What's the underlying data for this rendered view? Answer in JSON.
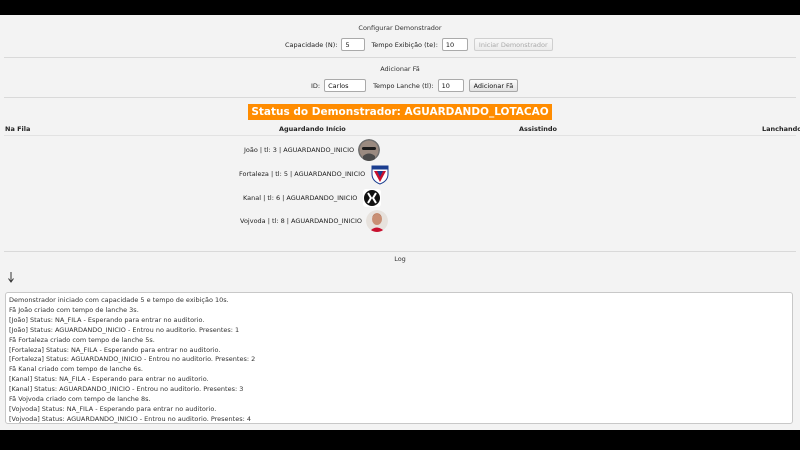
{
  "config": {
    "title": "Configurar Demonstrador",
    "capacity_label": "Capacidade (N):",
    "capacity_value": "5",
    "exhibit_label": "Tempo Exibição (te):",
    "exhibit_value": "10",
    "start_button": "Iniciar Demonstrador"
  },
  "add_fan": {
    "title": "Adicionar Fã",
    "id_label": "ID:",
    "id_value": "Carlos",
    "lunch_label": "Tempo Lanche (tl):",
    "lunch_value": "10",
    "add_button": "Adicionar Fã"
  },
  "status": {
    "text": "Status do Demonstrador: AGUARDANDO_LOTACAO",
    "color": "#ff8c00"
  },
  "columns": {
    "queue": "Na Fila",
    "waiting": "Aguardando Início",
    "watching": "Assistindo",
    "eating": "Lanchando"
  },
  "waiting_fans": [
    {
      "text": "João | tl: 3 | AGUARDANDO_INICIO",
      "avatar": "person-avatar-icon"
    },
    {
      "text": "Fortaleza | tl: 5 | AGUARDANDO_INICIO",
      "avatar": "fortaleza-crest-icon"
    },
    {
      "text": "Kanal | tl: 6 | AGUARDANDO_INICIO",
      "avatar": "kanal-logo-icon"
    },
    {
      "text": "Vojvoda | tl: 8 | AGUARDANDO_INICIO",
      "avatar": "person-avatar-icon"
    }
  ],
  "log": {
    "title": "Log",
    "lines": [
      "Demonstrador iniciado com capacidade 5 e tempo de exibição 10s.",
      "Fã João criado com tempo de lanche 3s.",
      "[João] Status: NA_FILA - Esperando para entrar no auditorio.",
      "[João] Status: AGUARDANDO_INICIO - Entrou no auditorio. Presentes: 1",
      "Fã Fortaleza criado com tempo de lanche 5s.",
      "[Fortaleza] Status: NA_FILA - Esperando para entrar no auditorio.",
      "[Fortaleza] Status: AGUARDANDO_INICIO - Entrou no auditorio. Presentes: 2",
      "Fã Kanal criado com tempo de lanche 6s.",
      "[Kanal] Status: NA_FILA - Esperando para entrar no auditorio.",
      "[Kanal] Status: AGUARDANDO_INICIO - Entrou no auditorio. Presentes: 3",
      "Fã Vojvoda criado com tempo de lanche 8s.",
      "[Vojvoda] Status: NA_FILA - Esperando para entrar no auditorio.",
      "[Vojvoda] Status: AGUARDANDO_INICIO - Entrou no auditorio. Presentes: 4"
    ]
  }
}
